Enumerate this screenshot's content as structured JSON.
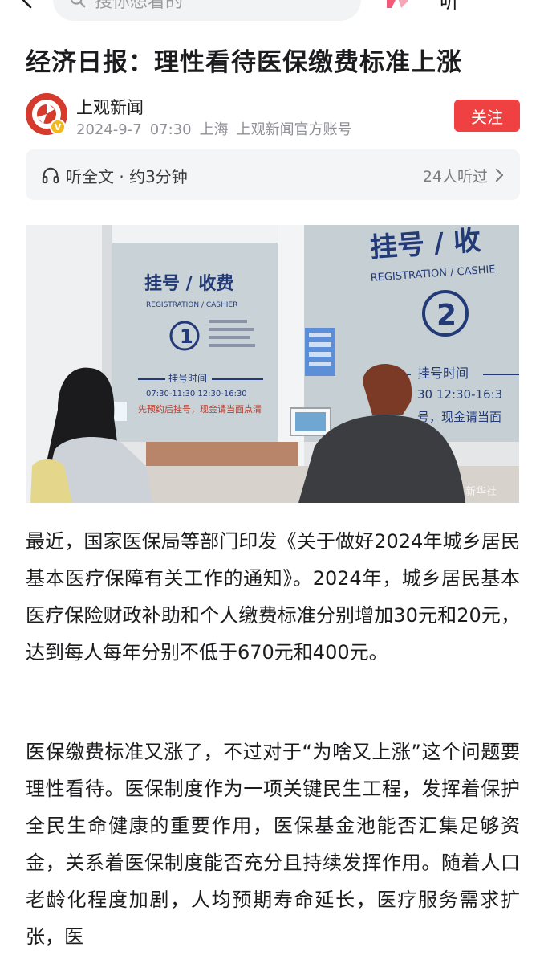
{
  "topbar": {
    "search_placeholder": "搜你想看的",
    "listen_label": "听"
  },
  "article": {
    "title": "经济日报：理性看待医保缴费标准上涨",
    "author": {
      "name": "上观新闻",
      "date": "2024-9-7",
      "time": "07:30",
      "location": "上海",
      "account_type": "上观新闻官方账号",
      "follow_label": "关注"
    },
    "listen": {
      "label": "听全文 · 约3分钟",
      "count": "24人听过"
    },
    "image": {
      "sign_left_cn": "挂号 / 收费",
      "sign_left_en": "REGISTRATION / CASHIER",
      "sign_left_num": "1",
      "sign_left_time_title": "挂号时间",
      "sign_left_time": "07:30-11:30  12:30-16:30",
      "sign_left_note": "先预约后挂号，现金请当面点清",
      "sign_right_cn": "挂号 / 收",
      "sign_right_en": "REGISTRATION / CASHIE",
      "sign_right_num": "2",
      "sign_right_time_title": "挂号时间",
      "sign_right_time": "30  12:30-16:3",
      "sign_right_note": "号，现金请当面",
      "watermark": "新华社"
    },
    "paragraphs": [
      "最近，国家医保局等部门印发《关于做好2024年城乡居民基本医疗保障有关工作的通知》。2024年，城乡居民基本医疗保险财政补助和个人缴费标准分别增加30元和20元，达到每人每年分别不低于670元和400元。",
      "医保缴费标准又涨了，不过对于“为啥又上涨”这个问题要理性看待。医保制度作为一项关键民生工程，发挥着保护全民生命健康的重要作用，医保基金池能否汇集足够资金，关系着医保制度能否充分且持续发挥作用。随着人口老龄化程度加剧，人均预期寿命延长，医疗服务需求扩张，医"
    ]
  },
  "colors": {
    "accent_red": "#f04142",
    "meta_gray": "#8e9095",
    "bar_bg": "#f4f5f7"
  }
}
